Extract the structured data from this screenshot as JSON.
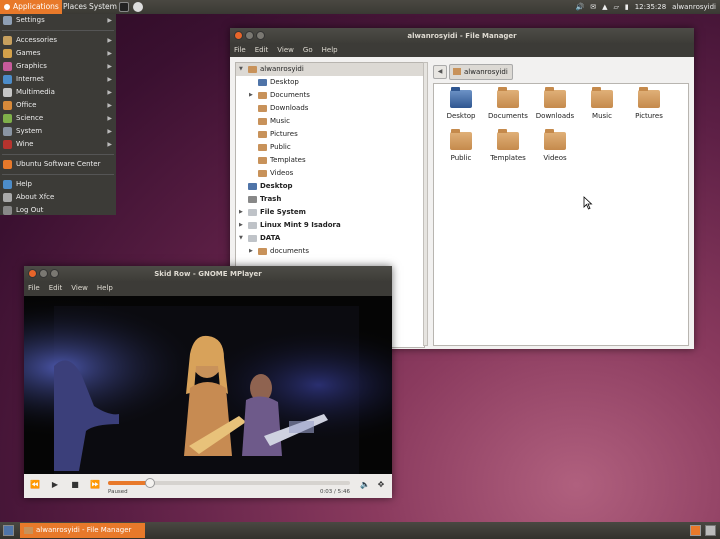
{
  "top_panel": {
    "applications": "Applications",
    "places": "Places",
    "system": "System",
    "clock": "12:35:28",
    "user": "alwanrosyidi"
  },
  "app_menu": {
    "items": [
      {
        "label": "Settings",
        "icon": "settings-icon",
        "color": "#8fa0b5",
        "submenu": true
      },
      {
        "label": "Accessories",
        "icon": "accessories-icon",
        "color": "#c7a05e",
        "submenu": true
      },
      {
        "label": "Games",
        "icon": "games-icon",
        "color": "#d4a14a",
        "submenu": true
      },
      {
        "label": "Graphics",
        "icon": "graphics-icon",
        "color": "#c65b9b",
        "submenu": true
      },
      {
        "label": "Internet",
        "icon": "internet-icon",
        "color": "#4c8cc9",
        "submenu": true
      },
      {
        "label": "Multimedia",
        "icon": "multimedia-icon",
        "color": "#c7c7c7",
        "submenu": true
      },
      {
        "label": "Office",
        "icon": "office-icon",
        "color": "#d88a3a",
        "submenu": true
      },
      {
        "label": "Science",
        "icon": "science-icon",
        "color": "#7fb04a",
        "submenu": true
      },
      {
        "label": "System",
        "icon": "system-icon",
        "color": "#8a95a3",
        "submenu": true
      },
      {
        "label": "Wine",
        "icon": "wine-icon",
        "color": "#b5332e",
        "submenu": true
      }
    ],
    "software_center": "Ubuntu Software Center",
    "help": "Help",
    "about": "About Xfce",
    "logout": "Log Out"
  },
  "file_manager": {
    "title": "alwanrosyidi - File Manager",
    "menu": [
      "File",
      "Edit",
      "View",
      "Go",
      "Help"
    ],
    "tree": [
      {
        "label": "alwanrosyidi",
        "level": 0,
        "icon": "home",
        "expander": "open",
        "selected": true
      },
      {
        "label": "Desktop",
        "level": 1,
        "icon": "blue",
        "expander": ""
      },
      {
        "label": "Documents",
        "level": 1,
        "icon": "folder",
        "expander": "closed"
      },
      {
        "label": "Downloads",
        "level": 1,
        "icon": "folder",
        "expander": ""
      },
      {
        "label": "Music",
        "level": 1,
        "icon": "folder",
        "expander": ""
      },
      {
        "label": "Pictures",
        "level": 1,
        "icon": "folder",
        "expander": ""
      },
      {
        "label": "Public",
        "level": 1,
        "icon": "folder",
        "expander": ""
      },
      {
        "label": "Templates",
        "level": 1,
        "icon": "folder",
        "expander": ""
      },
      {
        "label": "Videos",
        "level": 1,
        "icon": "folder",
        "expander": ""
      },
      {
        "label": "Desktop",
        "level": 0,
        "icon": "blue",
        "expander": "",
        "bold": true
      },
      {
        "label": "Trash",
        "level": 0,
        "icon": "grey",
        "expander": "",
        "bold": true
      },
      {
        "label": "File System",
        "level": 0,
        "icon": "drive",
        "expander": "closed",
        "bold": true
      },
      {
        "label": "Linux Mint 9 Isadora",
        "level": 0,
        "icon": "drive",
        "expander": "closed",
        "bold": true
      },
      {
        "label": "DATA",
        "level": 0,
        "icon": "drive",
        "expander": "open",
        "bold": true
      },
      {
        "label": "documents",
        "level": 1,
        "icon": "folder",
        "expander": "closed"
      }
    ],
    "location": "alwanrosyidi",
    "icons": [
      "Desktop",
      "Documents",
      "Downloads",
      "Music",
      "Pictures",
      "Public",
      "Templates",
      "Videos"
    ]
  },
  "mplayer": {
    "title": "Skid Row - GNOME MPlayer",
    "menu": [
      "File",
      "Edit",
      "View",
      "Help"
    ],
    "status": "Paused",
    "time": "0:03 / 5:46",
    "progress": 0.17
  },
  "taskbar": {
    "file_manager_task": "alwanrosyidi - File Manager"
  }
}
